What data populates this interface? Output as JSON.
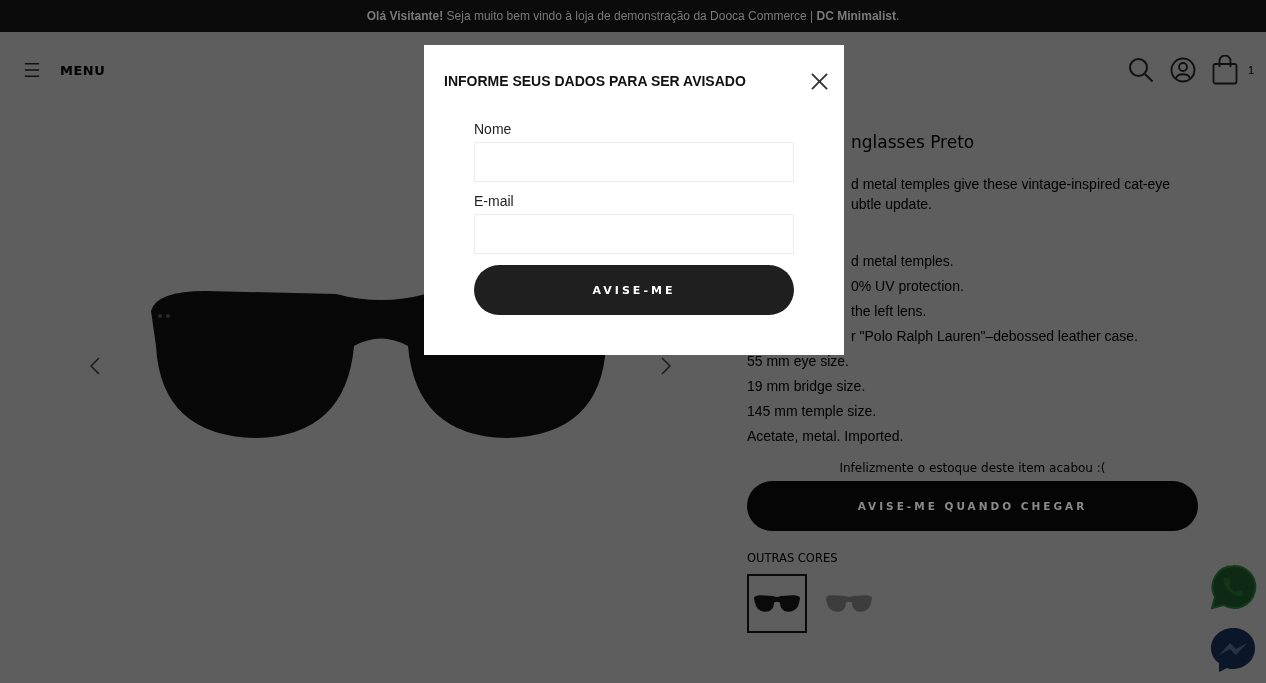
{
  "top_bar": {
    "text": "**Olá Visitante!** Seja muito bem vindo à loja de demonstração da Dooca Commerce | **DC Minimalist**."
  },
  "header": {
    "menu_label": "MENU",
    "cart_count": "1"
  },
  "product": {
    "title": "nglasses Preto",
    "description": [
      "d metal temples give these vintage-inspired cat-eye",
      "ubtle update."
    ],
    "details": [
      {
        "text": "d metal temples.",
        "covered": true
      },
      {
        "text": "0% UV protection.",
        "covered": true
      },
      {
        "text": "the left lens.",
        "covered": true
      },
      {
        "text": "r \"Polo Ralph Lauren\"–debossed leather case.",
        "covered": true
      },
      {
        "text": "55 mm eye size.",
        "covered": false
      },
      {
        "text": "19 mm bridge size.",
        "covered": false
      },
      {
        "text": "145 mm temple size.",
        "covered": false
      },
      {
        "text": "Acetate, metal. Imported.",
        "covered": false
      }
    ],
    "stock_message": "Infelizmente o estoque deste item acabou :(",
    "notify_button": "AVISE-ME QUANDO CHEGAR",
    "other_colors": {
      "label": "OUTRAS CORES",
      "swatches": [
        {
          "kind": "dark",
          "selected": true
        },
        {
          "kind": "light",
          "selected": false
        }
      ]
    }
  },
  "modal": {
    "title": "INFORME SEUS DADOS PARA SER AVISADO",
    "fields": [
      {
        "label": "Nome"
      },
      {
        "label": "E-mail"
      }
    ],
    "submit": "AVISE-ME"
  }
}
